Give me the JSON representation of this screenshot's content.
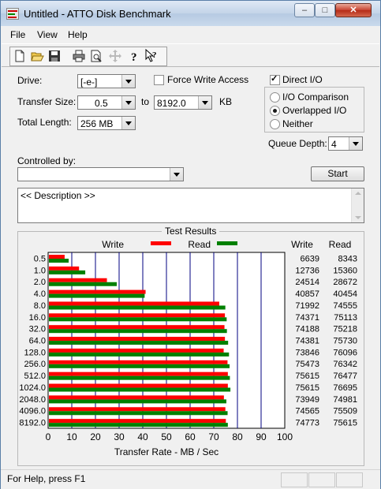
{
  "window": {
    "title": "Untitled - ATTO Disk Benchmark"
  },
  "menu": [
    "File",
    "View",
    "Help"
  ],
  "toolbar": {
    "icons": [
      "new-icon",
      "open-icon",
      "save-icon",
      "print-icon",
      "print-preview-icon",
      "move-icon",
      "help-icon",
      "context-help-icon"
    ]
  },
  "form": {
    "drive_label": "Drive:",
    "drive_value": "[-e-]",
    "force_write_label": "Force Write Access",
    "force_write_checked": false,
    "direct_io_label": "Direct I/O",
    "direct_io_checked": true,
    "transfer_size_label": "Transfer Size:",
    "transfer_from": "0.5",
    "to_label": "to",
    "transfer_to": "8192.0",
    "kb_label": "KB",
    "total_length_label": "Total Length:",
    "total_length_value": "256 MB",
    "io_options": [
      "I/O Comparison",
      "Overlapped I/O",
      "Neither"
    ],
    "io_selected": "Overlapped I/O",
    "queue_depth_label": "Queue Depth:",
    "queue_depth_value": "4",
    "controlled_by_label": "Controlled by:",
    "controlled_by_value": "",
    "start_label": "Start",
    "description": "<< Description >>"
  },
  "results": {
    "group_title": "Test Results",
    "legend_write": "Write",
    "legend_read": "Read",
    "col_write": "Write",
    "col_read": "Read",
    "write_color": "#ff0000",
    "read_color": "#008000"
  },
  "chart_data": {
    "type": "bar",
    "orientation": "horizontal",
    "categories": [
      "0.5",
      "1.0",
      "2.0",
      "4.0",
      "8.0",
      "16.0",
      "32.0",
      "64.0",
      "128.0",
      "256.0",
      "512.0",
      "1024.0",
      "2048.0",
      "4096.0",
      "8192.0"
    ],
    "series": [
      {
        "name": "Write",
        "values": [
          6639,
          12736,
          24514,
          40857,
          71992,
          74371,
          74188,
          74381,
          73846,
          75473,
          75615,
          75615,
          73949,
          74565,
          74773
        ]
      },
      {
        "name": "Read",
        "values": [
          8343,
          15360,
          28672,
          40454,
          74555,
          75113,
          75218,
          75730,
          76096,
          76342,
          76477,
          76695,
          74981,
          75509,
          75615
        ]
      }
    ],
    "xlabel": "Transfer Rate - MB / Sec",
    "xlim": [
      0,
      100
    ],
    "xticks": [
      "0",
      "10",
      "20",
      "30",
      "40",
      "50",
      "60",
      "70",
      "80",
      "90",
      "100"
    ]
  },
  "status": {
    "text": "For Help, press F1"
  }
}
